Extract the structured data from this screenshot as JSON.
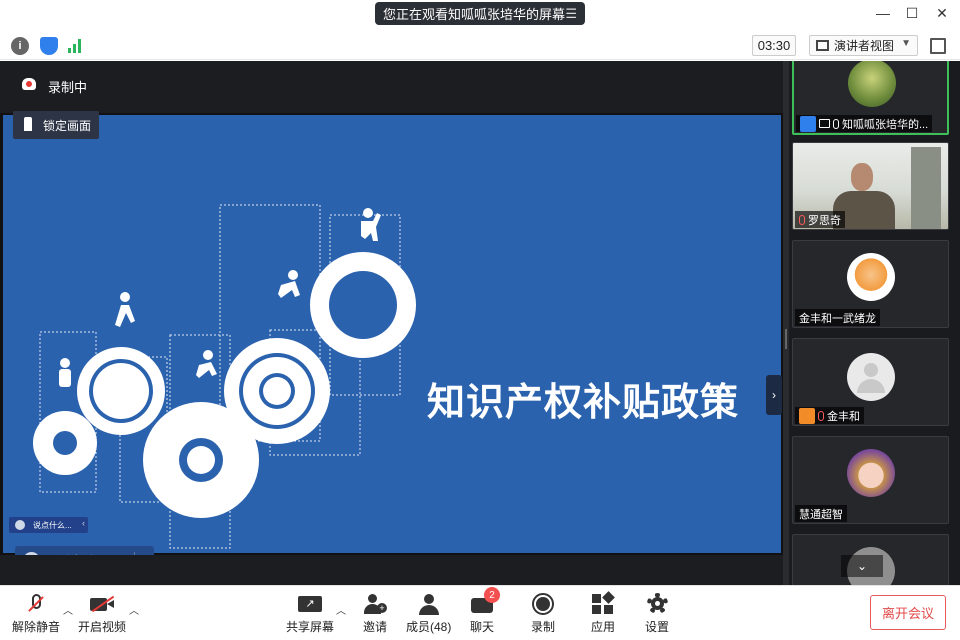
{
  "titlebar": {
    "share_notice": "您正在观看知呱呱张培华的屏幕"
  },
  "toolrow": {
    "timer": "03:30",
    "view_mode": "演讲者视图"
  },
  "stage": {
    "recording_label": "录制中",
    "lock_view_label": "锁定画面",
    "slide_title": "知识产权补贴政策",
    "chat_placeholder": "说点什么...",
    "chat_placeholder_mini": "说点什么..."
  },
  "participants": [
    {
      "name": "知呱呱张培华的...",
      "role": "host",
      "sharing": true,
      "mic": "on",
      "avatar": "bird"
    },
    {
      "name": "罗思奇",
      "mic": "off",
      "avatar": "video"
    },
    {
      "name": "金丰和一武绪龙",
      "avatar": "tiger"
    },
    {
      "name": "金丰和",
      "mic": "off",
      "avatar": "default"
    },
    {
      "name": "慧通超智",
      "avatar": "anime"
    },
    {
      "name": "",
      "avatar": "collapsed"
    }
  ],
  "toolbar": {
    "mute_label": "解除静音",
    "video_label": "开启视频",
    "share_label": "共享屏幕",
    "invite_label": "邀请",
    "members_label": "成员(48)",
    "chat_label": "聊天",
    "chat_badge": "2",
    "record_label": "录制",
    "apps_label": "应用",
    "settings_label": "设置",
    "leave_label": "离开会议"
  },
  "colors": {
    "slide_bg": "#2b62ae",
    "active_speaker": "#3fbf5a",
    "leave_red": "#e24a4a"
  }
}
